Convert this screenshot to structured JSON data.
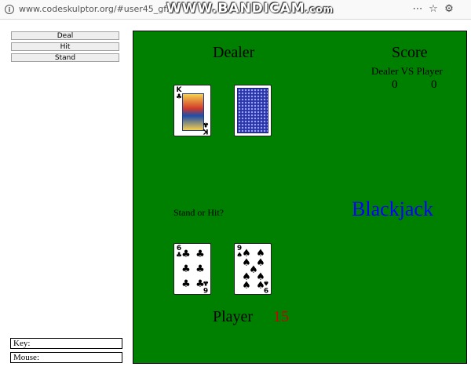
{
  "browser": {
    "url": "www.codeskulptor.org/#user45_gf2FUU6SiC",
    "watermark_main": "WWW.BANDICAM",
    "watermark_tld": ".com",
    "icons": [
      "info-icon",
      "more-icon",
      "bookmark-icon",
      "settings-icon"
    ]
  },
  "controls": {
    "deal_label": "Deal",
    "hit_label": "Hit",
    "stand_label": "Stand",
    "key_label": "Key:",
    "mouse_label": "Mouse:"
  },
  "game": {
    "dealer_label": "Dealer",
    "score_title": "Score",
    "score_header": "Dealer VS Player",
    "dealer_score": "0",
    "player_score": "0",
    "prompt": "Stand or Hit?",
    "title": "Blackjack",
    "player_label": "Player",
    "player_total": "15",
    "dealer_cards": [
      {
        "rank": "K",
        "suit": "♣",
        "face_up": true
      },
      {
        "face_up": false
      }
    ],
    "player_cards": [
      {
        "rank": "6",
        "suit": "♣"
      },
      {
        "rank": "9",
        "suit": "♠"
      }
    ],
    "colors": {
      "table": "#008000",
      "title": "#0000ff",
      "player_total": "#cc0000"
    }
  }
}
